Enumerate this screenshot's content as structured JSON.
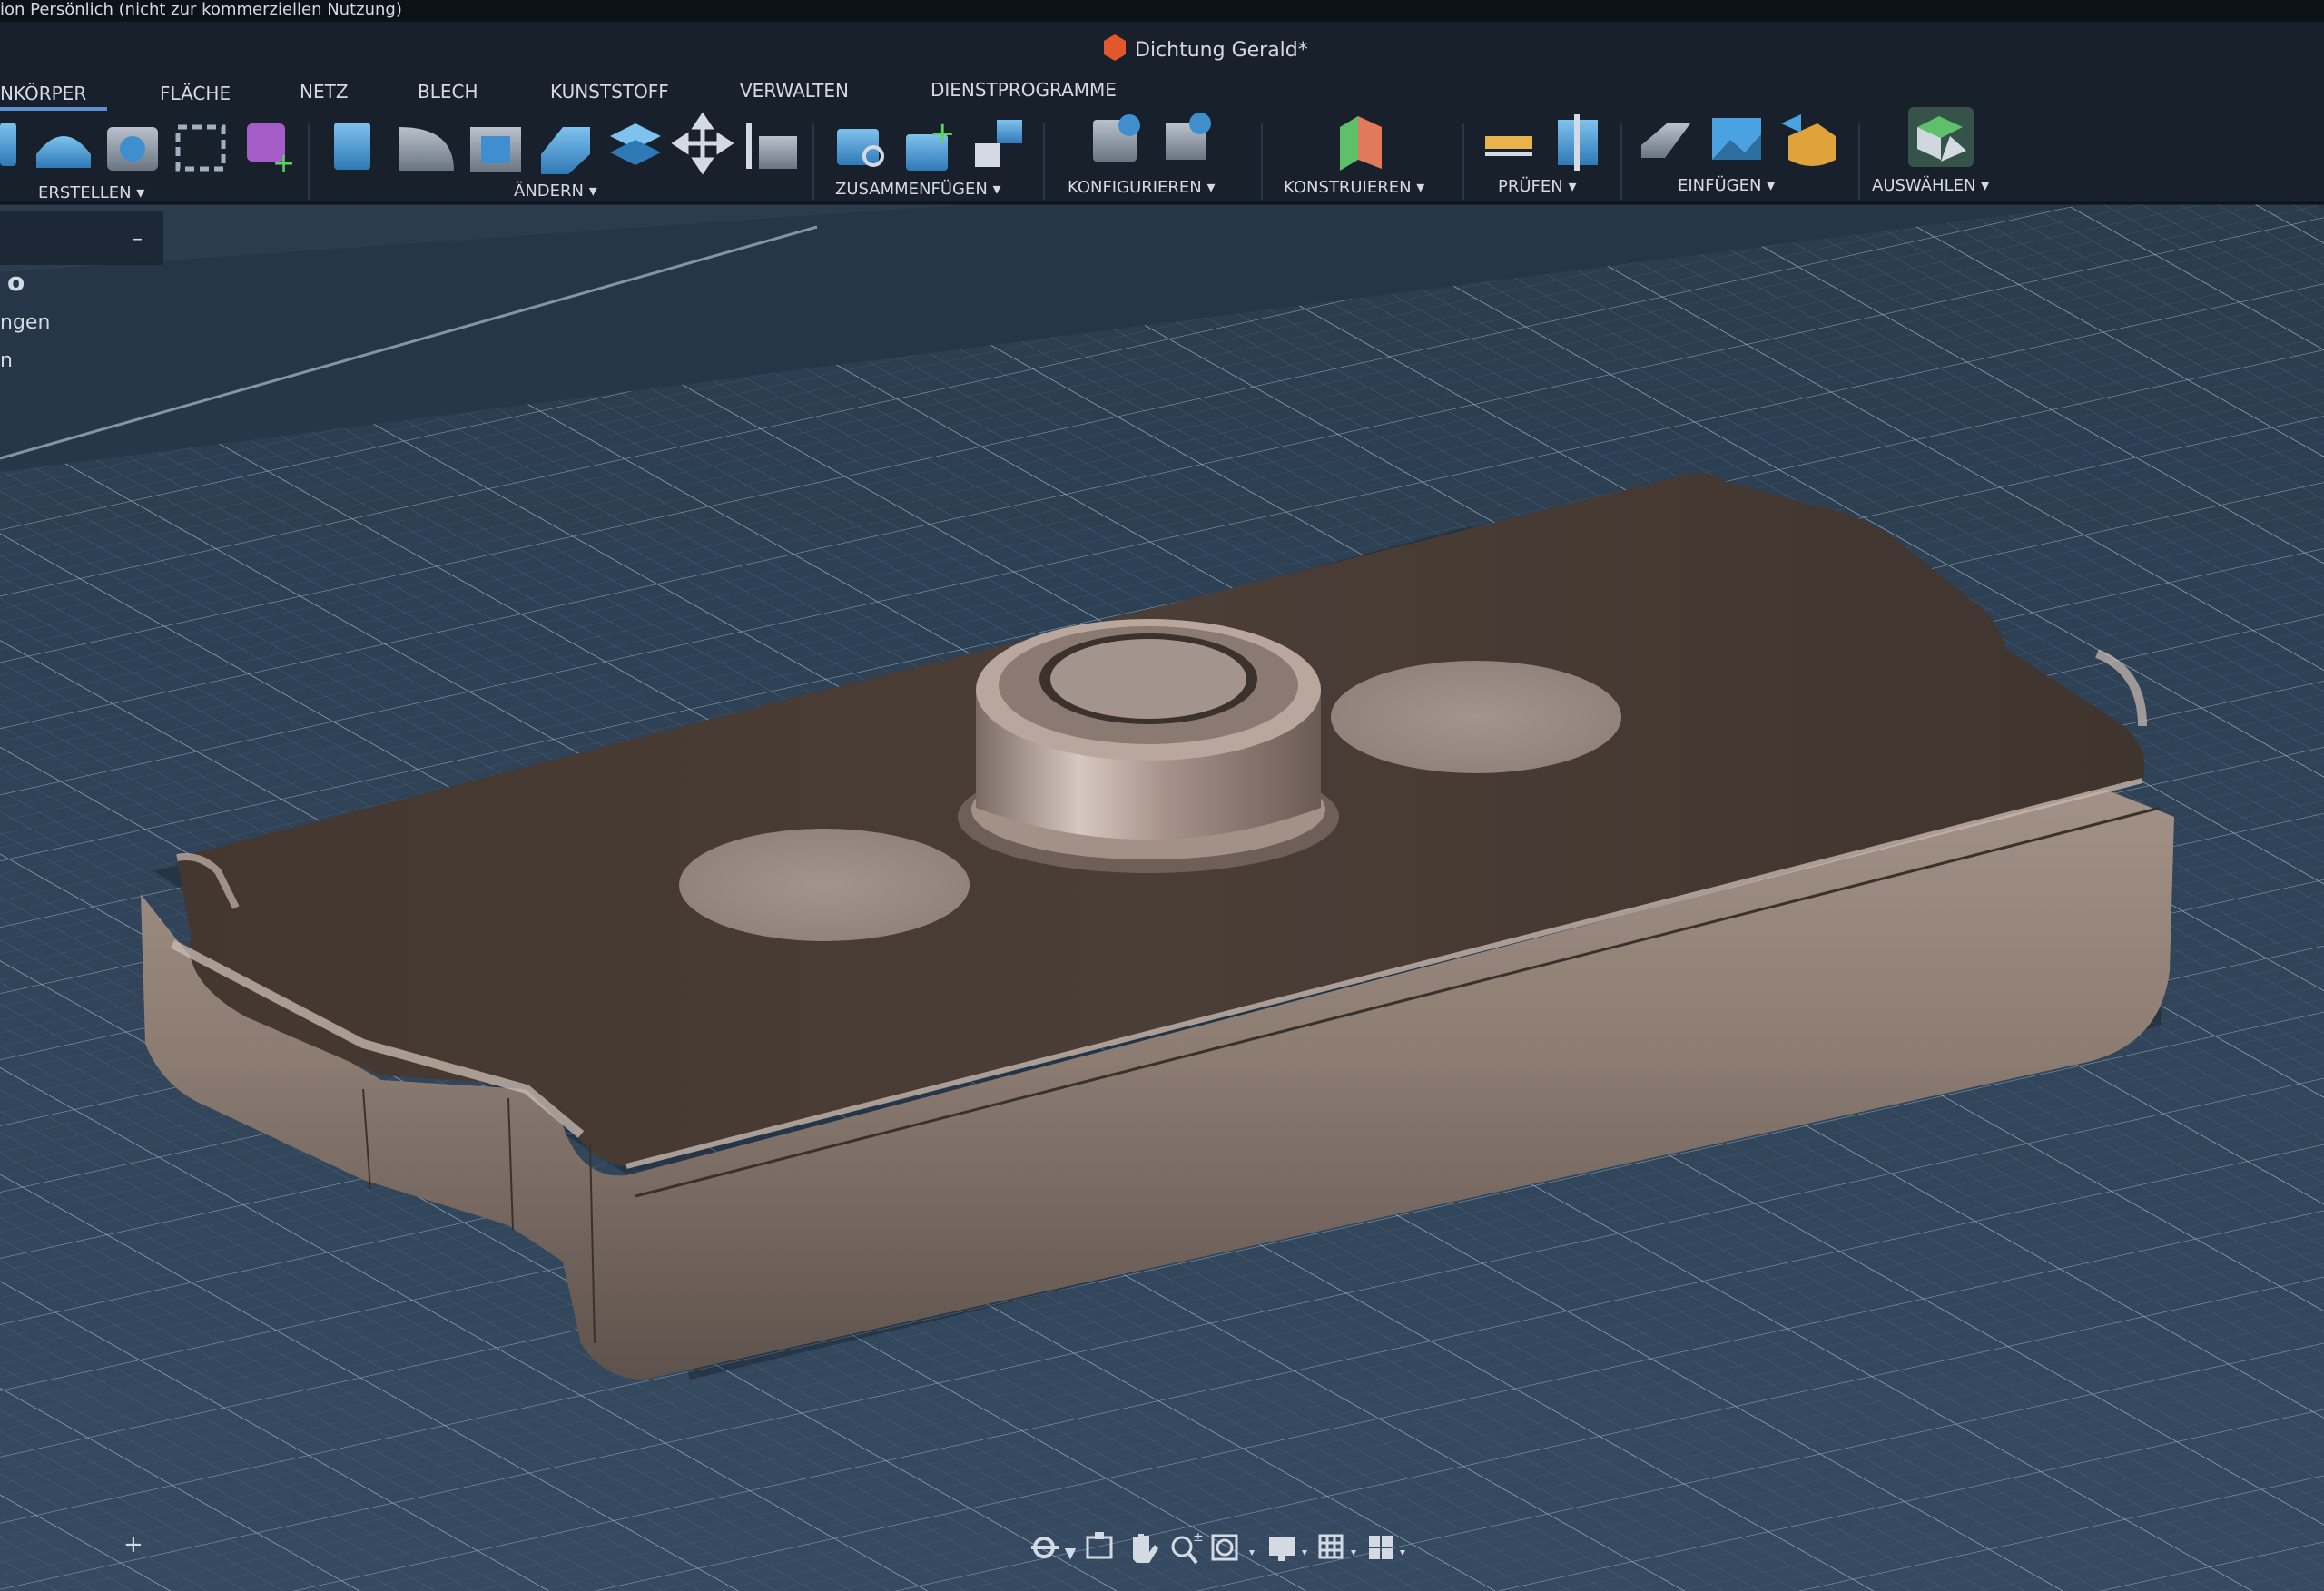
{
  "license_banner": "ion Persönlich (nicht zur kommerziellen Nutzung)",
  "document": {
    "title": "Dichtung Gerald*"
  },
  "tabs": [
    {
      "label": "NKÖRPER",
      "active": true
    },
    {
      "label": "FLÄCHE"
    },
    {
      "label": "NETZ"
    },
    {
      "label": "BLECH"
    },
    {
      "label": "KUNSTSTOFF"
    },
    {
      "label": "VERWALTEN"
    },
    {
      "label": "DIENSTPROGRAMME"
    }
  ],
  "groups": [
    {
      "label": "ERSTELLEN ▾"
    },
    {
      "label": "ÄNDERN ▾"
    },
    {
      "label": "ZUSAMMENFÜGEN ▾"
    },
    {
      "label": "KONFIGURIEREN ▾"
    },
    {
      "label": "KONSTRUIEREN ▾"
    },
    {
      "label": "PRÜFEN ▾"
    },
    {
      "label": "EINFÜGEN ▾"
    },
    {
      "label": "AUSWÄHLEN ▾"
    }
  ],
  "browser": {
    "collapse_glyph": "–",
    "radio_glyph": "o",
    "items": [
      "ngen",
      "n"
    ]
  },
  "bottom": {
    "add_glyph": "+"
  },
  "colors": {
    "ribbon_bg": "#18202b",
    "grid_bg": "#2f4256",
    "grid_line": "#5c7389",
    "model_top": "#4a3d37",
    "model_side": "#8b7a70",
    "accent_orange": "#e2572b",
    "label_text": "#d4dae3"
  },
  "icons": {
    "ribbon": [
      "extrude-icon",
      "revolve-icon",
      "box-icon",
      "pattern-icon",
      "component-icon",
      "press-pull-icon",
      "fillet-icon",
      "shell-icon",
      "combine-icon",
      "split-icon",
      "move-icon",
      "align-icon",
      "joint-icon",
      "new-joint-icon",
      "rigid-group-icon",
      "parameters-icon",
      "configure-table-icon",
      "plane-icon",
      "measure-icon",
      "section-icon",
      "decal-icon",
      "canvas-icon",
      "insert-mesh-icon",
      "select-icon"
    ],
    "navbar": [
      "orbit-icon",
      "look-at-icon",
      "pan-icon",
      "zoom-icon",
      "fit-icon",
      "display-settings-icon",
      "grid-settings-icon",
      "viewports-icon"
    ]
  }
}
